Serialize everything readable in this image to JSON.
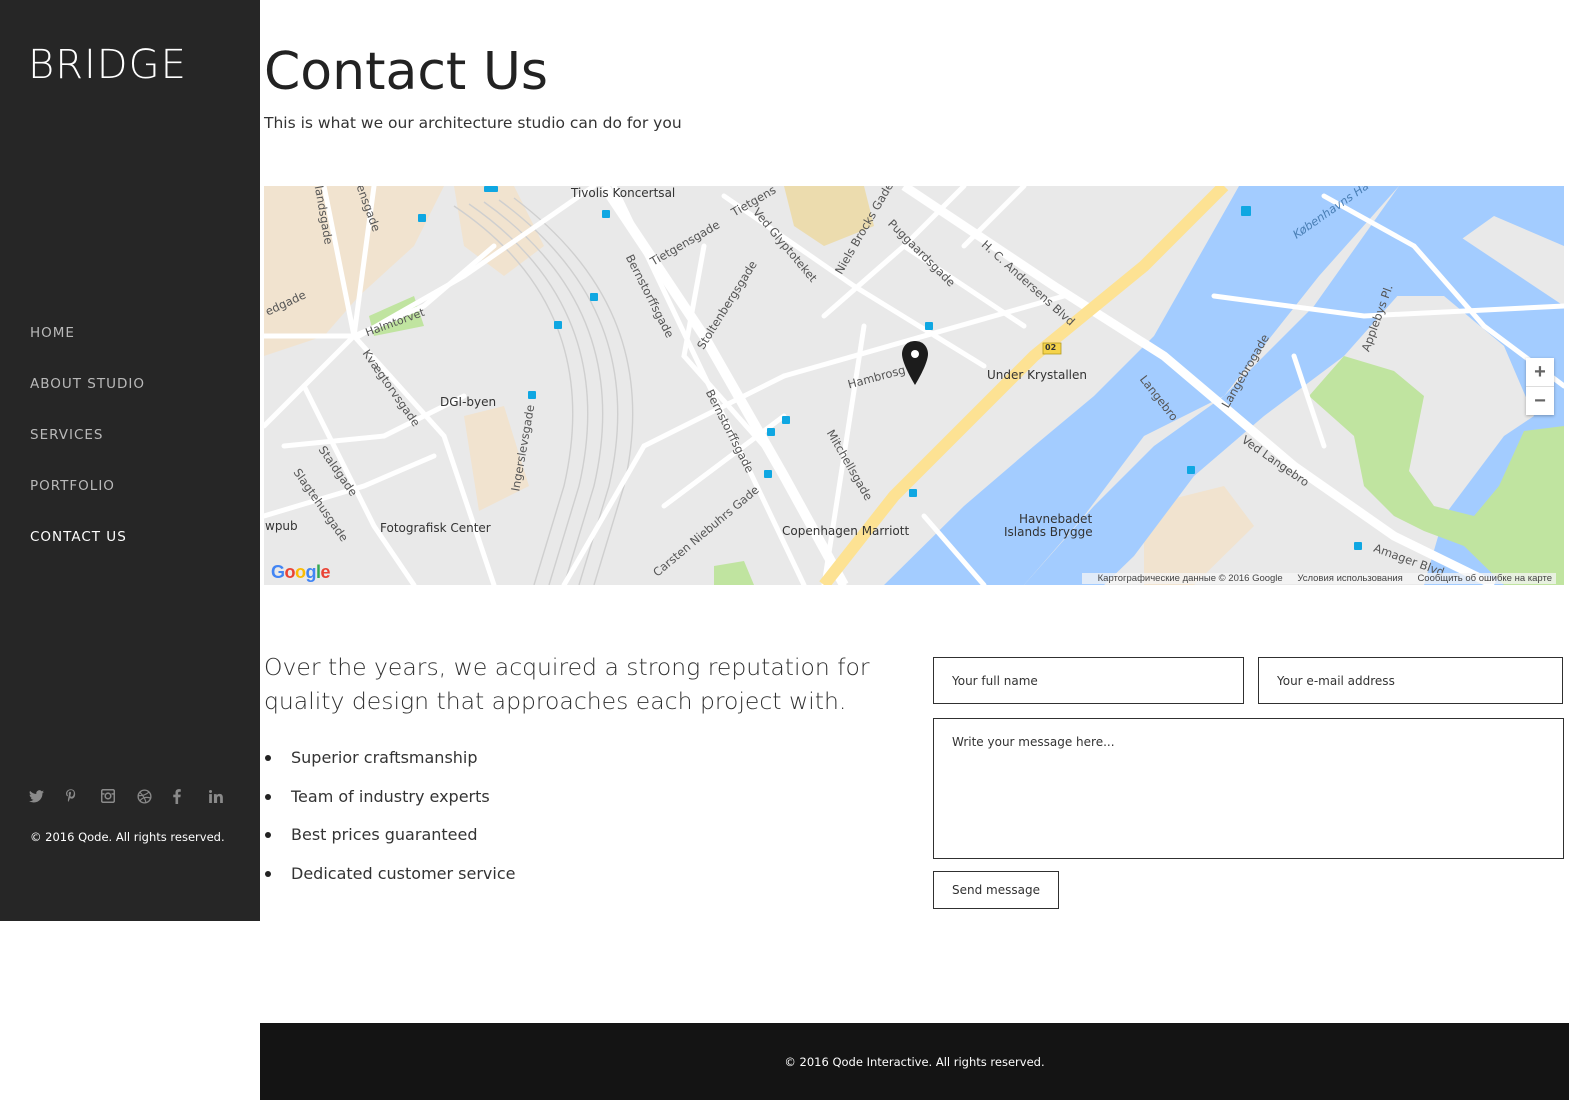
{
  "brand": {
    "logo": "BRIDGE"
  },
  "nav": [
    {
      "label": "HOME"
    },
    {
      "label": "ABOUT STUDIO"
    },
    {
      "label": "SERVICES"
    },
    {
      "label": "PORTFOLIO"
    },
    {
      "label": "CONTACT US"
    }
  ],
  "social": [
    {
      "icon": "twitter-icon",
      "glyph": "🐦"
    },
    {
      "icon": "pinterest-icon",
      "glyph": "𝓅"
    },
    {
      "icon": "instagram-icon",
      "glyph": "◘"
    },
    {
      "icon": "dribbble-icon",
      "glyph": "⊛"
    },
    {
      "icon": "facebook-icon",
      "glyph": "f"
    },
    {
      "icon": "linkedin-icon",
      "glyph": "in"
    }
  ],
  "sidebar_copyright": "© 2016 Qode. All rights reserved.",
  "page": {
    "title": "Contact Us",
    "subtitle": "This is what we our architecture studio can do for you"
  },
  "map": {
    "labels": {
      "tivolis": "Tivolis Koncertsal",
      "halmtorvet": "Halmtorvet",
      "dgi": "DGI-byen",
      "fotografisk": "Fotografisk Center",
      "wpub": "wpub",
      "marriott": "Copenhagen Marriott",
      "krystallen": "Under Krystallen",
      "havnebadet": "Havnebadet",
      "islands": "Islands Brygge",
      "hambros": "Hambrosg",
      "bernstorff1": "Bernstorffsgade",
      "bernstorff2": "Bernstorffsgade",
      "stoltenberg": "Stoltenbergsgade",
      "glyptotek": "Ved Glyptoteket",
      "nielsbrock": "Niels Brocks Gade",
      "puggaard": "Puggaardsgade",
      "hcandersens": "H. C. Andersens Blvd",
      "langebro": "Langebro",
      "vedlangebro": "Ved Langebro",
      "langebrogade": "Langebrogade",
      "amager": "Amager Blvd",
      "mitchell": "Mitchellsgade",
      "carsten": "Carsten Niebuhrs Gade",
      "ingerslev": "Ingerslevsgade",
      "kvaegtorv": "Kvægtorvsgade",
      "staldgade": "Staldgade",
      "slagtehus": "Slagtehusgade",
      "tietgen1": "Tietgensgade",
      "tietgen2": "Tietgens",
      "applebys": "Applebys Pl.",
      "kobenhavns": "Københavns Ha",
      "landsgade": "landsgade",
      "ensgade": "ensgade",
      "edgade": "edgade",
      "route": "02"
    },
    "zoom_in": "+",
    "zoom_out": "−",
    "google": "Google",
    "credit_data": "Картографические данные © 2016 Google",
    "credit_terms": "Условия использования",
    "credit_report": "Сообщить об ошибке на карте",
    "colors": {
      "water": "#a3ccff",
      "park": "#c0e4a0",
      "road_major": "#fde293",
      "land": "#e9e9e9",
      "building": "#f1e3cf"
    }
  },
  "about": {
    "lead": "Over the years, we acquired a strong reputation for quality design that approaches each project with.",
    "features": [
      "Superior craftsmanship",
      "Team of industry experts",
      "Best prices guaranteed",
      "Dedicated customer service"
    ]
  },
  "form": {
    "name_placeholder": "Your full name",
    "email_placeholder": "Your e-mail address",
    "message_placeholder": "Write your message here...",
    "send_label": "Send message"
  },
  "footer": {
    "copyright": "© 2016 Qode Interactive. All rights reserved."
  }
}
